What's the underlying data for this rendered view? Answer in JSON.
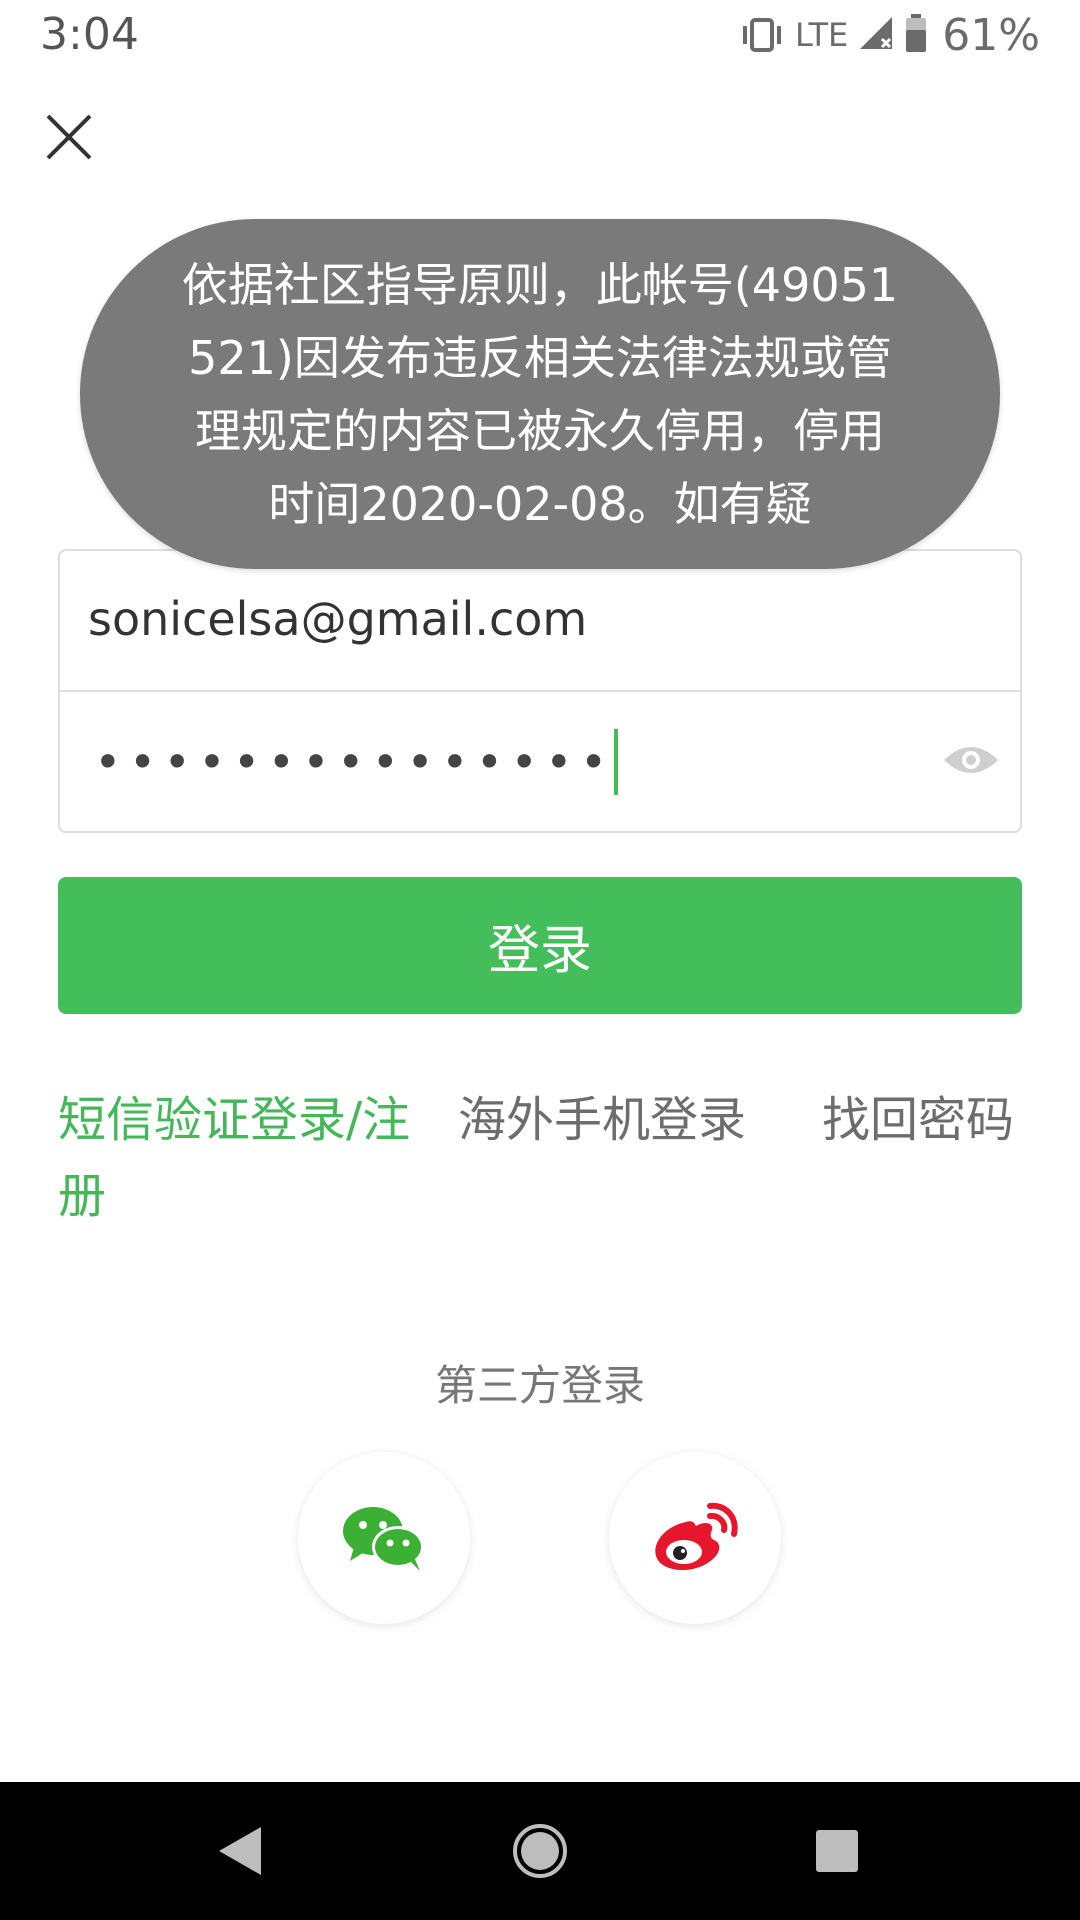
{
  "status_bar": {
    "time": "3:04",
    "network": "LTE",
    "battery": "61%",
    "icons": [
      "vibrate-icon",
      "signal-icon",
      "battery-icon"
    ]
  },
  "header": {
    "close_icon": "close-icon"
  },
  "toast": {
    "message": "依据社区指导原则，此帐号(49051521)因发布违反相关法律法规或管理规定的内容已被永久停用，停用时间2020-02-08。如有疑"
  },
  "form": {
    "email_value": "sonicelsa@gmail.com",
    "password_masked": "•••••••••••••••",
    "eye_icon": "eye-icon"
  },
  "login_button": {
    "label": "登录"
  },
  "links": {
    "sms_login": "短信验证登录/注册",
    "overseas_login": "海外手机登录",
    "forgot_password": "找回密码"
  },
  "third_party": {
    "title": "第三方登录",
    "providers": [
      {
        "name": "wechat",
        "icon": "wechat-icon"
      },
      {
        "name": "weibo",
        "icon": "weibo-icon"
      }
    ]
  },
  "nav_bar": {
    "icons": [
      "back-icon",
      "home-icon",
      "recents-icon"
    ]
  },
  "colors": {
    "accent_green": "#43be5a",
    "link_green": "#45b75a",
    "toast_bg": "#7a7a7a",
    "weibo_red": "#e6162d",
    "wechat_green": "#3cb034"
  }
}
